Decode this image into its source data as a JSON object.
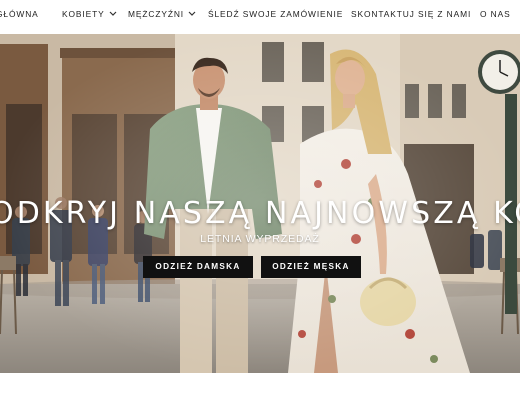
{
  "nav": {
    "items": [
      {
        "label": "GŁÓWNA",
        "has_dropdown": false
      },
      {
        "label": "KOBIETY",
        "has_dropdown": true
      },
      {
        "label": "MĘŻCZYŹNI",
        "has_dropdown": true
      },
      {
        "label": "ŚLEDŹ SWOJE ZAMÓWIENIE",
        "has_dropdown": false
      },
      {
        "label": "SKONTAKTUJ SIĘ Z NAMI",
        "has_dropdown": false
      },
      {
        "label": "O NAS",
        "has_dropdown": false
      }
    ],
    "dropdown_icon": "chevron-down-icon"
  },
  "hero": {
    "headline": "ODKRYJ NASZĄ NAJNOWSZĄ KOLEKCJĘ",
    "subheadline": "LETNIA WYPRZEDAŻ",
    "buttons": [
      {
        "label": "ODZIEŻ DAMSKA"
      },
      {
        "label": "ODZIEŻ MĘSKA"
      }
    ]
  },
  "colors": {
    "button_bg": "#111111",
    "button_text": "#ffffff",
    "nav_text": "#222222"
  }
}
